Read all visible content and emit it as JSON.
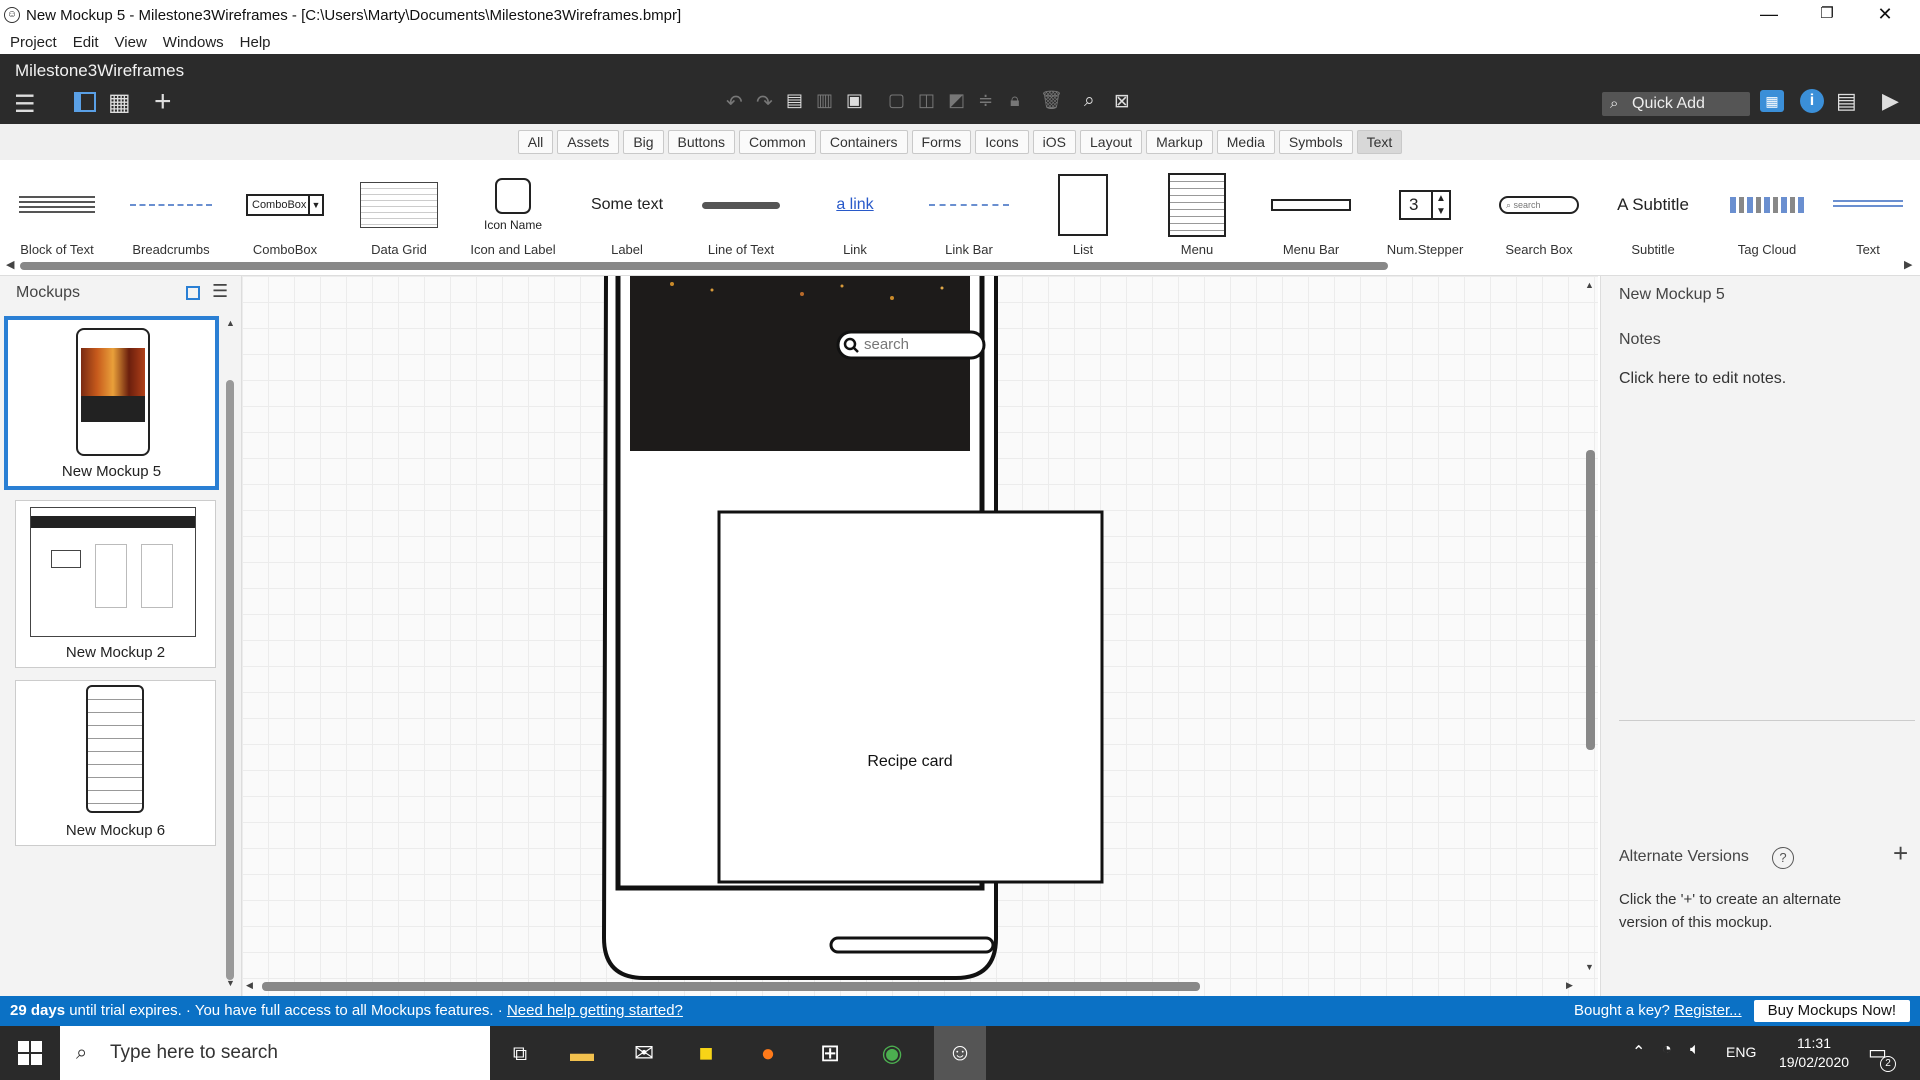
{
  "window": {
    "title": "New Mockup 5 - Milestone3Wireframes - [C:\\Users\\Marty\\Documents\\Milestone3Wireframes.bmpr]",
    "min": "—",
    "restore": "❐",
    "close": "✕"
  },
  "menu": [
    "Project",
    "Edit",
    "View",
    "Windows",
    "Help"
  ],
  "toolbar": {
    "project_name": "Milestone3Wireframes",
    "quick_add": "Quick Add"
  },
  "categories": [
    "All",
    "Assets",
    "Big",
    "Buttons",
    "Common",
    "Containers",
    "Forms",
    "Icons",
    "iOS",
    "Layout",
    "Markup",
    "Media",
    "Symbols",
    "Text"
  ],
  "active_category": "Text",
  "library": {
    "items": [
      "Block of Text",
      "Breadcrumbs",
      "ComboBox",
      "Data Grid",
      "Icon and Label",
      "Label",
      "Line of Text",
      "Link",
      "Link Bar",
      "List",
      "Menu",
      "Menu Bar",
      "Num.Stepper",
      "Search Box",
      "Subtitle",
      "Tag Cloud",
      "Text"
    ],
    "previews": {
      "combobox": "ComboBox",
      "icon_name": "Icon Name",
      "label": "Some text",
      "link": "a link",
      "stepper": "3",
      "search": "search",
      "subtitle": "A Subtitle"
    }
  },
  "mockups_panel": {
    "title": "Mockups",
    "items": [
      "New Mockup 5",
      "New Mockup 2",
      "New Mockup 6"
    ]
  },
  "canvas": {
    "search_placeholder": "search",
    "recipe_card": "Recipe card"
  },
  "right_panel": {
    "title": "New Mockup 5",
    "notes_heading": "Notes",
    "notes_hint": "Click here to edit notes.",
    "alt_heading": "Alternate Versions",
    "alt_hint": "Click the '+' to create an alternate version of this mockup."
  },
  "trial": {
    "days": "29 days",
    "message": "until trial expires. · You have full access to all Mockups features. ·",
    "help_link": "Need help getting started?",
    "key_text": "Bought a key?",
    "register": "Register...",
    "buy": "Buy Mockups Now!"
  },
  "taskbar": {
    "search_placeholder": "Type here to search",
    "lang": "ENG",
    "time": "11:31",
    "date": "19/02/2020",
    "notif_count": "2"
  }
}
